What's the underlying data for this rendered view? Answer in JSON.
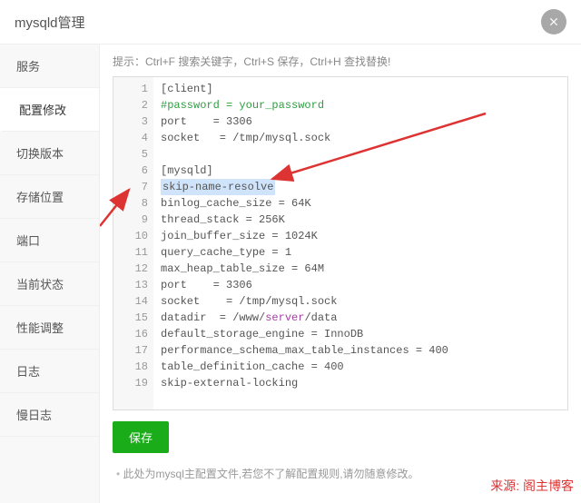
{
  "header": {
    "title": "mysqld管理"
  },
  "sidebar": {
    "tabs": [
      {
        "label": "服务"
      },
      {
        "label": "配置修改"
      },
      {
        "label": "切换版本"
      },
      {
        "label": "存储位置"
      },
      {
        "label": "端口"
      },
      {
        "label": "当前状态"
      },
      {
        "label": "性能调整"
      },
      {
        "label": "日志"
      },
      {
        "label": "慢日志"
      }
    ],
    "active_index": 1
  },
  "main": {
    "hint": "提示：Ctrl+F 搜索关键字，Ctrl+S 保存，Ctrl+H 查找替换!",
    "save_label": "保存",
    "note": "此处为mysql主配置文件,若您不了解配置规则,请勿随意修改。"
  },
  "editor": {
    "highlight_line": 7,
    "lines": [
      {
        "n": 1,
        "segs": [
          {
            "t": "[client]"
          }
        ]
      },
      {
        "n": 2,
        "segs": [
          {
            "t": "#password = your_password",
            "cls": "green"
          }
        ]
      },
      {
        "n": 3,
        "segs": [
          {
            "t": "port    = 3306"
          }
        ]
      },
      {
        "n": 4,
        "segs": [
          {
            "t": "socket   = /tmp/mysql.sock"
          }
        ]
      },
      {
        "n": 5,
        "segs": [
          {
            "t": ""
          }
        ]
      },
      {
        "n": 6,
        "segs": [
          {
            "t": "[mysqld]"
          }
        ]
      },
      {
        "n": 7,
        "segs": [
          {
            "t": "skip-name-resolve"
          }
        ]
      },
      {
        "n": 8,
        "segs": [
          {
            "t": "binlog_cache_size = 64K"
          }
        ]
      },
      {
        "n": 9,
        "segs": [
          {
            "t": "thread_stack = 256K"
          }
        ]
      },
      {
        "n": 10,
        "segs": [
          {
            "t": "join_buffer_size = 1024K"
          }
        ]
      },
      {
        "n": 11,
        "segs": [
          {
            "t": "query_cache_type = 1"
          }
        ]
      },
      {
        "n": 12,
        "segs": [
          {
            "t": "max_heap_table_size = 64M"
          }
        ]
      },
      {
        "n": 13,
        "segs": [
          {
            "t": "port    = 3306"
          }
        ]
      },
      {
        "n": 14,
        "segs": [
          {
            "t": "socket    = /tmp/mysql.sock"
          }
        ]
      },
      {
        "n": 15,
        "segs": [
          {
            "t": "datadir  = /www/"
          },
          {
            "t": "server",
            "cls": "purple"
          },
          {
            "t": "/data"
          }
        ]
      },
      {
        "n": 16,
        "segs": [
          {
            "t": "default_storage_engine = InnoDB"
          }
        ]
      },
      {
        "n": 17,
        "segs": [
          {
            "t": "performance_schema_max_table_instances = 400"
          }
        ]
      },
      {
        "n": 18,
        "segs": [
          {
            "t": "table_definition_cache = 400"
          }
        ]
      },
      {
        "n": 19,
        "segs": [
          {
            "t": "skip-external-locking"
          }
        ]
      }
    ]
  },
  "source_label": "来源: 阁主博客"
}
